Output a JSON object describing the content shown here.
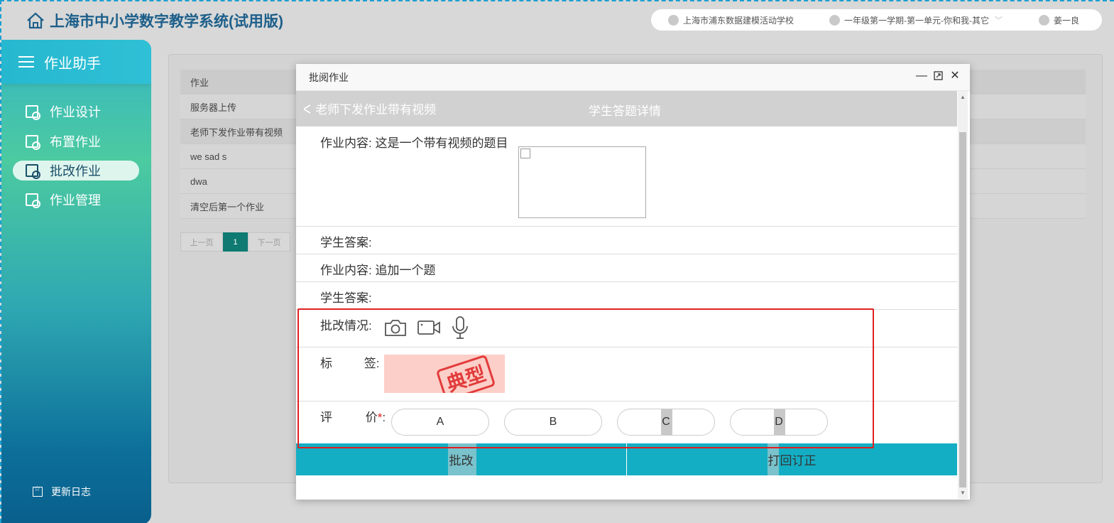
{
  "header": {
    "app_title": "上海市中小学数字教学系统(试用版)",
    "school": "上海市浦东数据建模活动学校",
    "term": "一年级第一学期-第一单元-你和我-其它",
    "user": "姜一良"
  },
  "sidebar": {
    "title": "作业助手",
    "items": [
      {
        "label": "作业设计"
      },
      {
        "label": "布置作业"
      },
      {
        "label": "批改作业"
      },
      {
        "label": "作业管理"
      }
    ],
    "footer": "更新日志"
  },
  "background": {
    "table_header": "作业",
    "rows": [
      "服务器上传",
      "老师下发作业带有视频",
      "we sad s",
      "dwa",
      "清空后第一个作业"
    ],
    "pager": {
      "prev": "上一页",
      "current": "1",
      "next": "下一页"
    }
  },
  "modal": {
    "title": "批阅作业",
    "back_label": "老师下发作业带有视频",
    "nav_title": "学生答题详情",
    "q1_label": "作业内容:",
    "q1_text": "这是一个带有视频的题目",
    "a1_label": "学生答案:",
    "q2_label": "作业内容:",
    "q2_text": "追加一个题",
    "a2_label": "学生答案:",
    "grading_label": "批改情况:",
    "tag_label_a": "标",
    "tag_label_b": "签:",
    "tag_stamp": "典型",
    "eval_label_a": "评",
    "eval_label_b": "价",
    "eval_required": "*",
    "eval_colon": ":",
    "grades": [
      "A",
      "B",
      "C",
      "D"
    ],
    "approve_label": "批改",
    "return_label": "打回订正"
  }
}
